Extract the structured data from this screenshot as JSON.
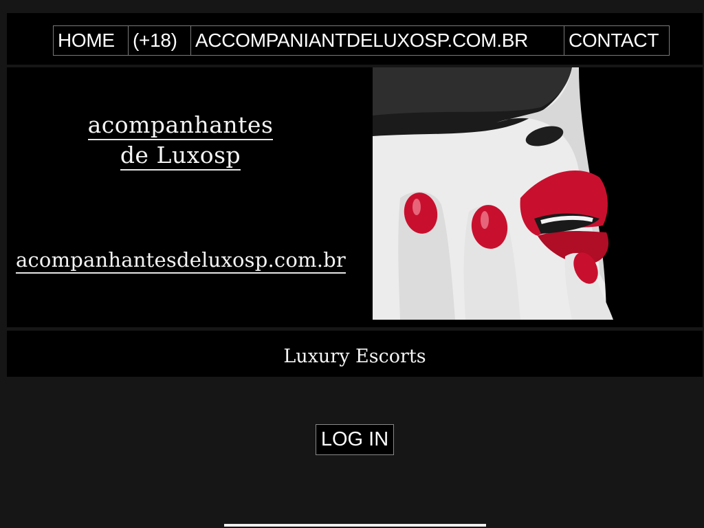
{
  "nav": {
    "items": [
      {
        "label": "HOME"
      },
      {
        "label": "(+18)"
      },
      {
        "label": "ACCOMPANIANTDELUXOSP.COM.BR"
      },
      {
        "label": "CONTACT"
      }
    ]
  },
  "hero": {
    "title_line1": "acompanhantes",
    "title_line2": "de Luxosp",
    "url": "acompanhantesdeluxosp.com.br",
    "image_icon": "red-lips-photo-icon"
  },
  "tagline": "Luxury Escorts",
  "login": {
    "label": "LOG IN"
  },
  "colors": {
    "background": "#161616",
    "panel": "#000000",
    "accent": "#c8102e",
    "text": "#ffffff"
  }
}
